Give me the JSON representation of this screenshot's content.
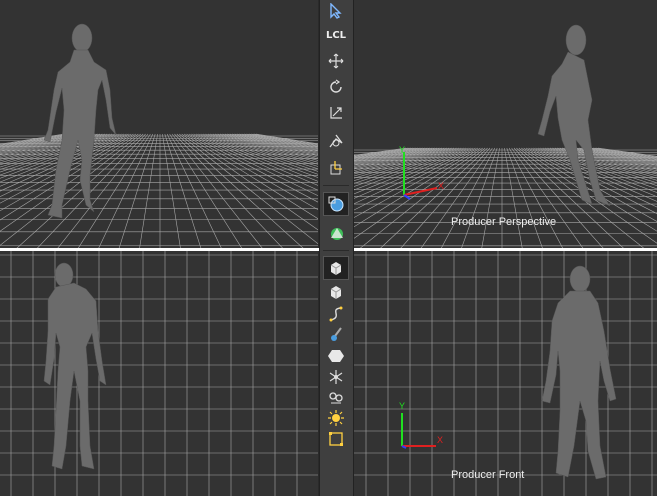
{
  "viewports": {
    "top_left": {
      "label": ""
    },
    "top_right": {
      "label": "Producer Perspective"
    },
    "bottom_left": {
      "label": ""
    },
    "bottom_right": {
      "label": "Producer Front"
    }
  },
  "axis_labels": {
    "x": "X",
    "y": "Y"
  },
  "colors": {
    "viewport_bg": "#333333",
    "grid": "#a8a8a8",
    "toolbar_bg": "#3f3f3f",
    "axis_x": "#e02020",
    "axis_y": "#20e020",
    "axis_z": "#3040ff",
    "separator": "#ffffff"
  },
  "toolbar": {
    "items": [
      {
        "name": "select-icon"
      },
      {
        "name": "local-space-icon",
        "label": "LCL"
      },
      {
        "name": "move-icon"
      },
      {
        "name": "rotate-icon"
      },
      {
        "name": "scale-icon"
      },
      {
        "name": "universal-manipulator-icon"
      },
      {
        "name": "pivot-icon"
      },
      {
        "name": "orbit-camera-icon"
      },
      {
        "name": "navigation-icon"
      },
      {
        "name": "cube-selected-icon"
      },
      {
        "name": "cube-icon"
      },
      {
        "name": "curve-icon"
      },
      {
        "name": "paint-brush-icon"
      },
      {
        "name": "polygon-icon"
      },
      {
        "name": "skeleton-icon"
      },
      {
        "name": "constraint-icon"
      },
      {
        "name": "light-icon"
      },
      {
        "name": "frame-icon"
      }
    ]
  }
}
